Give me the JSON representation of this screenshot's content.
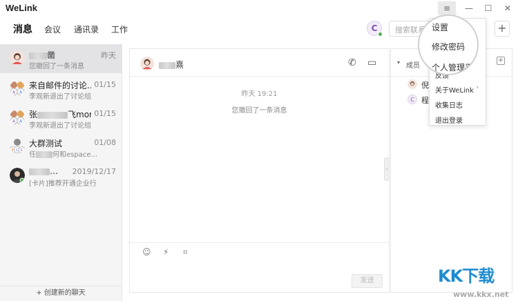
{
  "app": {
    "title": "WeLink"
  },
  "window": {
    "menu_icon": "≡",
    "minimize_icon": "—",
    "maximize_icon": "☐",
    "close_icon": "✕"
  },
  "topnav": {
    "tabs": [
      {
        "label": "消息",
        "active": true
      },
      {
        "label": "会议",
        "active": false
      },
      {
        "label": "通讯录",
        "active": false
      },
      {
        "label": "工作",
        "active": false
      }
    ],
    "avatar_letter": "C",
    "search_placeholder": "搜索联系人",
    "add_icon": "+"
  },
  "conversations": [
    {
      "name_suffix": "凿",
      "time": "昨天",
      "preview": "您撤回了一条消息",
      "avatar": "person"
    },
    {
      "name": "来自邮件的讨论...",
      "time": "01/15",
      "preview": "李观新退出了讨论组",
      "avatar": "group"
    },
    {
      "name_prefix": "张",
      "name_suffix": "飞mori...",
      "time": "01/15",
      "preview": "李观新退出了讨论组",
      "avatar": "group"
    },
    {
      "name": "大群测试",
      "time": "01/08",
      "preview_prefix": "任",
      "preview_suffix": "何和espace...",
      "avatar": "group2"
    },
    {
      "name_suffix": "…",
      "time": "2019/12/17",
      "preview": "[卡片]推荐开通企业行",
      "avatar": "photo"
    }
  ],
  "create_chat": "+ 创建新的聊天",
  "chat": {
    "title_suffix": "熹",
    "call_icon": "✆",
    "video_icon": "▭",
    "message_time": "昨天 19:21",
    "system_message": "您撤回了一条消息",
    "tools": {
      "emoji": "☺",
      "lightning": "⚡",
      "crop": "⌗"
    },
    "send_label": "发送",
    "handle_icon": "›"
  },
  "members": {
    "label": "成员",
    "caret": "▾",
    "add_icon": "+",
    "list": [
      {
        "name": "倪"
      },
      {
        "name": "程"
      }
    ]
  },
  "menu": {
    "items": [
      {
        "label": "设置"
      },
      {
        "label": "修改密码"
      },
      {
        "label": "个人管理平"
      },
      {
        "label": "反馈"
      },
      {
        "label": "关于WeLink",
        "has_submenu": true
      },
      {
        "label": "收集日志"
      },
      {
        "label": "退出登录"
      }
    ],
    "submenu_icon": "›"
  },
  "watermark": {
    "text": "KK下载",
    "url": "www.kkx.net"
  },
  "colors": {
    "accent_green": "#4cb04f",
    "watermark_blue": "#1e8cd0"
  }
}
